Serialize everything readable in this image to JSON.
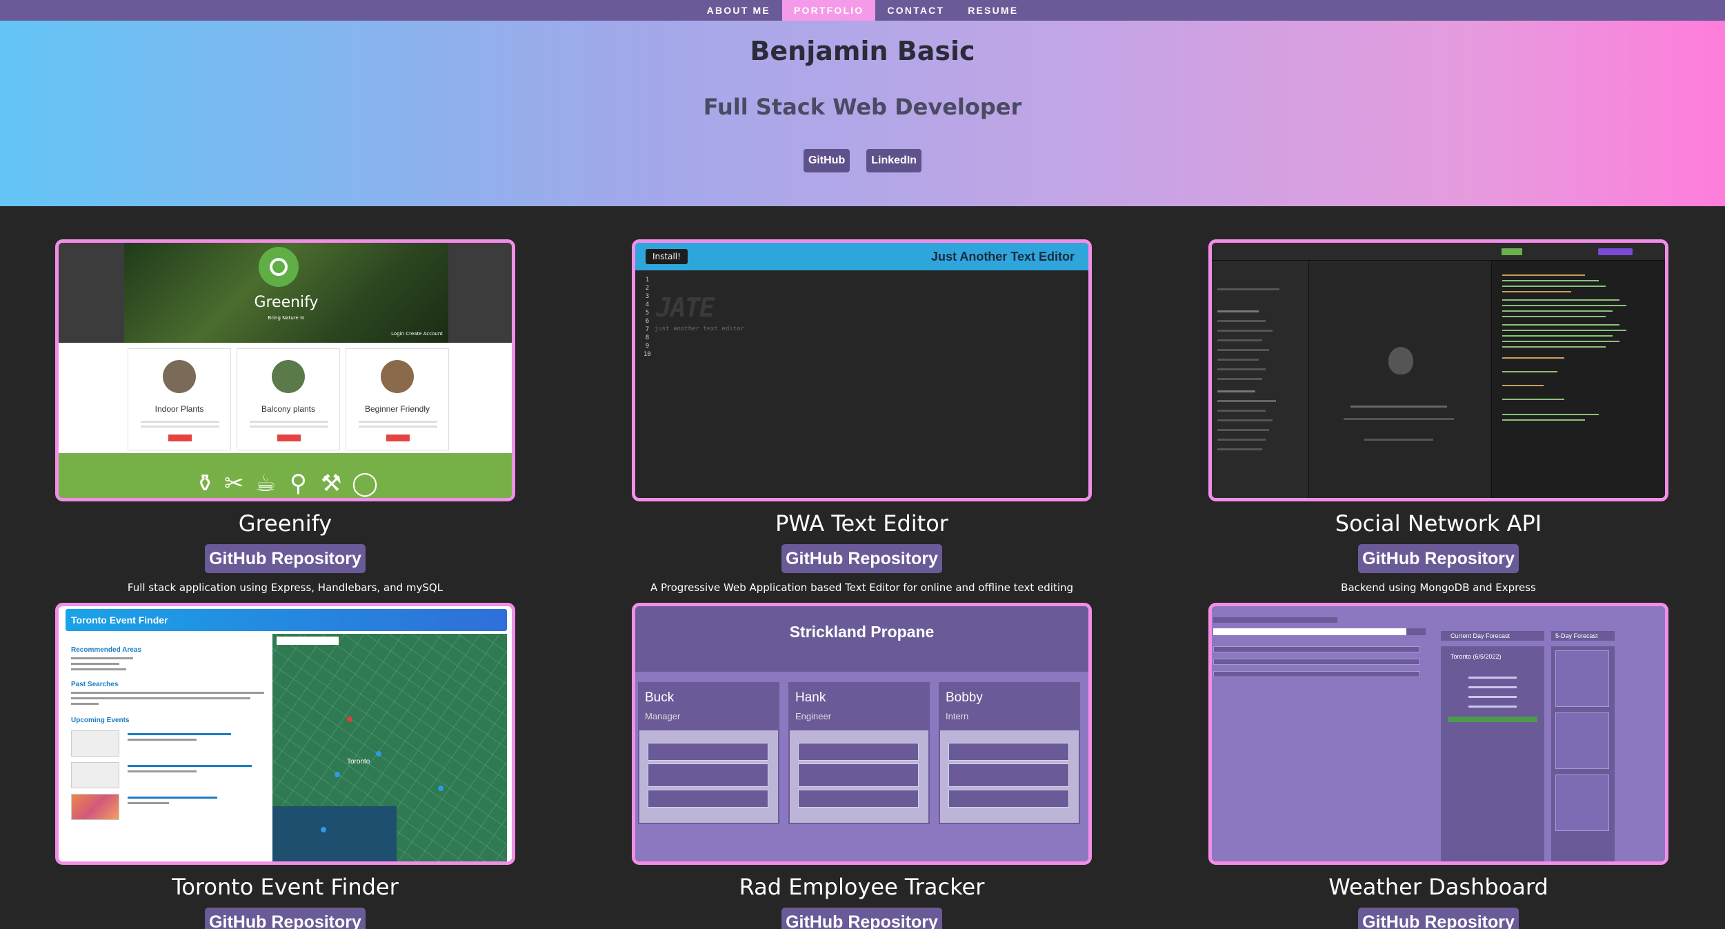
{
  "nav": {
    "items": [
      {
        "label": "ABOUT ME"
      },
      {
        "label": "PORTFOLIO"
      },
      {
        "label": "CONTACT"
      },
      {
        "label": "RESUME"
      }
    ],
    "active": "PORTFOLIO"
  },
  "header": {
    "name": "Benjamin Basic",
    "role": "Full Stack Web Developer",
    "links": [
      {
        "label": "GitHub"
      },
      {
        "label": "LinkedIn"
      }
    ]
  },
  "projects": [
    {
      "title": "Greenify",
      "button": "GitHub Repository",
      "description": "Full stack application using Express, Handlebars, and mySQL",
      "preview": {
        "brand": "Greenify",
        "tagline": "Bring Nature In",
        "auth": "Login   Create Account",
        "cards": [
          "Indoor Plants",
          "Balcony plants",
          "Beginner Friendly"
        ]
      }
    },
    {
      "title": "PWA Text Editor",
      "button": "GitHub Repository",
      "description": "A Progressive Web Application based Text Editor for online and offline text editing",
      "preview": {
        "install": "Install!",
        "app_title": "Just Another Text Editor",
        "line_numbers": "1\n2\n3\n4\n5\n6\n7\n8\n9\n10",
        "art": "JATE",
        "subtitle": "just another text editor"
      }
    },
    {
      "title": "Social Network API",
      "button": "GitHub Repository",
      "description": "Backend using MongoDB and Express",
      "preview": {}
    },
    {
      "title": "Toronto Event Finder",
      "button": "GitHub Repository",
      "description": "",
      "preview": {
        "app_title": "Toronto Event Finder",
        "sections": [
          "Recommended Areas",
          "Past Searches",
          "Upcoming Events"
        ],
        "map_label": "Toronto"
      }
    },
    {
      "title": "Rad Employee Tracker",
      "button": "GitHub Repository",
      "description": "",
      "preview": {
        "app_title": "Strickland Propane",
        "employees": [
          {
            "name": "Buck",
            "role": "Manager"
          },
          {
            "name": "Hank",
            "role": "Engineer"
          },
          {
            "name": "Bobby",
            "role": "Intern"
          }
        ]
      }
    },
    {
      "title": "Weather Dashboard",
      "button": "GitHub Repository",
      "description": "",
      "preview": {
        "current_header": "Current Day Forecast",
        "forecast_header": "5-Day Forecast",
        "city": "Toronto (6/5/2022)"
      }
    }
  ],
  "colors": {
    "nav_bg": "#6a5b98",
    "nav_active": "#f59ae8",
    "accent_border": "#f28ee7",
    "button_bg": "#6a5b98",
    "page_bg": "#262626"
  }
}
